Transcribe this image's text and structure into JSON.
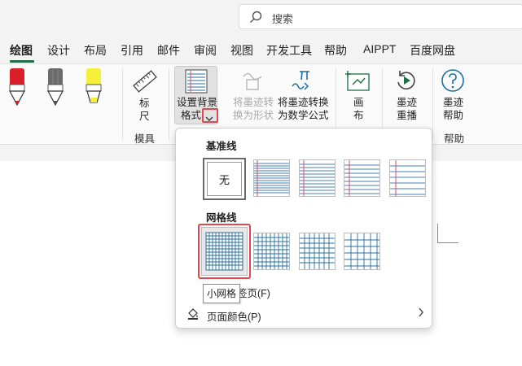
{
  "search": {
    "placeholder": "搜索"
  },
  "tabs": [
    {
      "label": "绘图",
      "active": true
    },
    {
      "label": "设计"
    },
    {
      "label": "布局"
    },
    {
      "label": "引用"
    },
    {
      "label": "邮件"
    },
    {
      "label": "审阅"
    },
    {
      "label": "视图"
    },
    {
      "label": "开发工具"
    },
    {
      "label": "帮助"
    },
    {
      "label": "AIPPT"
    },
    {
      "label": "百度网盘"
    }
  ],
  "ribbon": {
    "pens": [
      {
        "name": "red-pen",
        "color": "#d9202a"
      },
      {
        "name": "gray-pencil",
        "color": "#6b6b6b"
      },
      {
        "name": "yellow-highlighter",
        "color": "#f6ef3c"
      }
    ],
    "ruler_line1": "标",
    "ruler_line2": "尺",
    "bg_format_line1": "设置背景",
    "bg_format_line2": "格式",
    "ink_to_shape_line1": "将墨迹转",
    "ink_to_shape_line2": "换为形状",
    "ink_to_math_line1": "将墨迹转换",
    "ink_to_math_line2": "为数学公式",
    "canvas_line1": "画",
    "canvas_line2": "布",
    "ink_replay_line1": "墨迹",
    "ink_replay_line2": "重播",
    "ink_help_line1": "墨迹",
    "ink_help_line2": "帮助",
    "group_stencils": "模具",
    "group_help": "帮助"
  },
  "dropdown": {
    "section_ruled": "基准线",
    "none_label": "无",
    "section_grid": "网格线",
    "tooltip": "小网格",
    "item_page_color": "页面颜色(P)",
    "item_partial": "签页(F)"
  },
  "colors": {
    "accent": "#1e6e46",
    "highlight_red": "#e0474e",
    "grid_blue": "#2a6f9e",
    "line_blue": "#4a7fb5",
    "margin_red": "#d2506b",
    "icon_teal": "#1d6fa5"
  }
}
